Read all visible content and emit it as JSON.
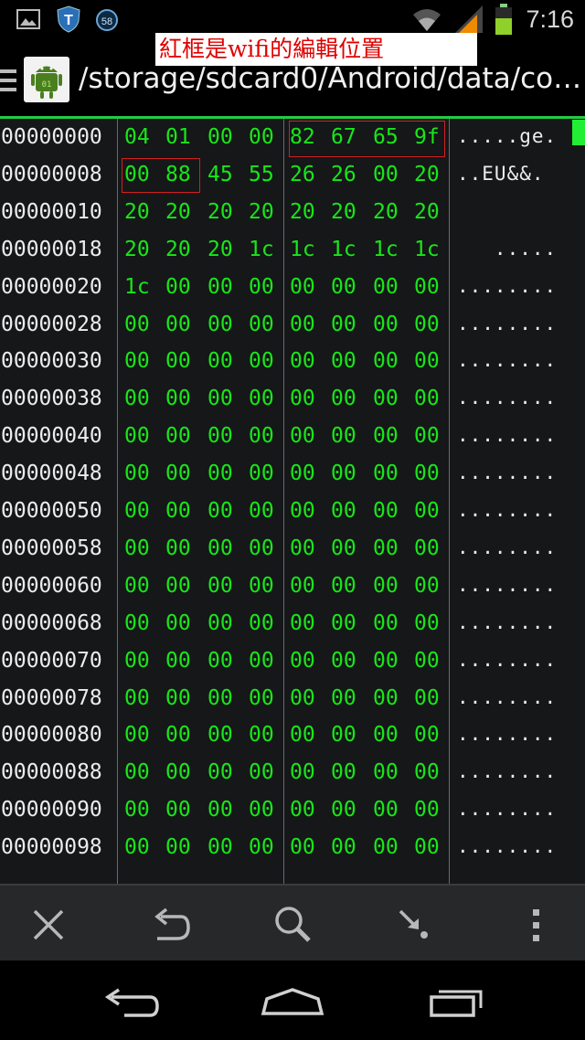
{
  "status_bar": {
    "time": "7:16",
    "notification_badge": "58",
    "icons": [
      "image-icon",
      "shield-t-icon",
      "badge-58-icon",
      "wifi-icon",
      "signal-icon",
      "battery-icon"
    ]
  },
  "action_bar": {
    "path": "/storage/sdcard0/Android/data/co…",
    "app_icon": "android-app-icon"
  },
  "annotation": {
    "text": "紅框是wifi的編輯位置",
    "color": "#e00000"
  },
  "hex_view": {
    "rows": [
      {
        "addr": "00000000",
        "bytes": [
          "04",
          "01",
          "00",
          "00",
          "82",
          "67",
          "65",
          "9f"
        ],
        "ascii": ".....ge."
      },
      {
        "addr": "00000008",
        "bytes": [
          "00",
          "88",
          "45",
          "55",
          "26",
          "26",
          "00",
          "20"
        ],
        "ascii": "..EU&&."
      },
      {
        "addr": "00000010",
        "bytes": [
          "20",
          "20",
          "20",
          "20",
          "20",
          "20",
          "20",
          "20"
        ],
        "ascii": ""
      },
      {
        "addr": "00000018",
        "bytes": [
          "20",
          "20",
          "20",
          "1c",
          "1c",
          "1c",
          "1c",
          "1c"
        ],
        "ascii": "   ....."
      },
      {
        "addr": "00000020",
        "bytes": [
          "1c",
          "00",
          "00",
          "00",
          "00",
          "00",
          "00",
          "00"
        ],
        "ascii": "........"
      },
      {
        "addr": "00000028",
        "bytes": [
          "00",
          "00",
          "00",
          "00",
          "00",
          "00",
          "00",
          "00"
        ],
        "ascii": "........"
      },
      {
        "addr": "00000030",
        "bytes": [
          "00",
          "00",
          "00",
          "00",
          "00",
          "00",
          "00",
          "00"
        ],
        "ascii": "........"
      },
      {
        "addr": "00000038",
        "bytes": [
          "00",
          "00",
          "00",
          "00",
          "00",
          "00",
          "00",
          "00"
        ],
        "ascii": "........"
      },
      {
        "addr": "00000040",
        "bytes": [
          "00",
          "00",
          "00",
          "00",
          "00",
          "00",
          "00",
          "00"
        ],
        "ascii": "........"
      },
      {
        "addr": "00000048",
        "bytes": [
          "00",
          "00",
          "00",
          "00",
          "00",
          "00",
          "00",
          "00"
        ],
        "ascii": "........"
      },
      {
        "addr": "00000050",
        "bytes": [
          "00",
          "00",
          "00",
          "00",
          "00",
          "00",
          "00",
          "00"
        ],
        "ascii": "........"
      },
      {
        "addr": "00000058",
        "bytes": [
          "00",
          "00",
          "00",
          "00",
          "00",
          "00",
          "00",
          "00"
        ],
        "ascii": "........"
      },
      {
        "addr": "00000060",
        "bytes": [
          "00",
          "00",
          "00",
          "00",
          "00",
          "00",
          "00",
          "00"
        ],
        "ascii": "........"
      },
      {
        "addr": "00000068",
        "bytes": [
          "00",
          "00",
          "00",
          "00",
          "00",
          "00",
          "00",
          "00"
        ],
        "ascii": "........"
      },
      {
        "addr": "00000070",
        "bytes": [
          "00",
          "00",
          "00",
          "00",
          "00",
          "00",
          "00",
          "00"
        ],
        "ascii": "........"
      },
      {
        "addr": "00000078",
        "bytes": [
          "00",
          "00",
          "00",
          "00",
          "00",
          "00",
          "00",
          "00"
        ],
        "ascii": "........"
      },
      {
        "addr": "00000080",
        "bytes": [
          "00",
          "00",
          "00",
          "00",
          "00",
          "00",
          "00",
          "00"
        ],
        "ascii": "........"
      },
      {
        "addr": "00000088",
        "bytes": [
          "00",
          "00",
          "00",
          "00",
          "00",
          "00",
          "00",
          "00"
        ],
        "ascii": "........"
      },
      {
        "addr": "00000090",
        "bytes": [
          "00",
          "00",
          "00",
          "00",
          "00",
          "00",
          "00",
          "00"
        ],
        "ascii": "........"
      },
      {
        "addr": "00000098",
        "bytes": [
          "00",
          "00",
          "00",
          "00",
          "00",
          "00",
          "00",
          "00"
        ],
        "ascii": "........"
      }
    ],
    "byte_color": "#19e619",
    "highlight_color": "#d42020"
  },
  "toolbar": {
    "buttons": [
      "close-icon",
      "undo-icon",
      "search-icon",
      "goto-icon",
      "overflow-menu-icon"
    ]
  },
  "nav_bar": {
    "buttons": [
      "back-icon",
      "home-icon",
      "recents-icon"
    ]
  }
}
